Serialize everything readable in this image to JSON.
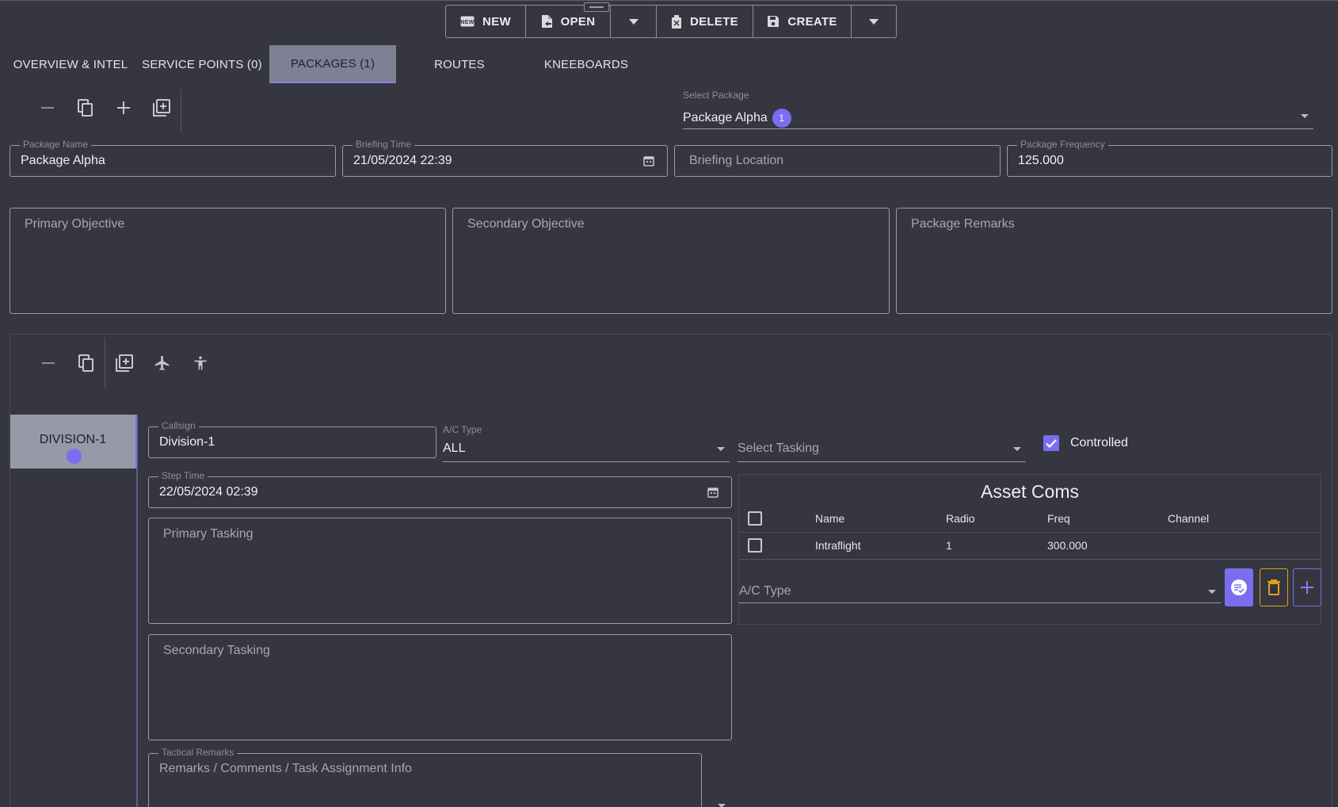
{
  "toolbar": {
    "new_label": "NEW",
    "open_label": "OPEN",
    "delete_label": "DELETE",
    "create_label": "CREATE"
  },
  "tabs": [
    {
      "label": "OVERVIEW & INTEL"
    },
    {
      "label": "SERVICE POINTS (0)"
    },
    {
      "label": "PACKAGES (1)",
      "active": true
    },
    {
      "label": "ROUTES"
    },
    {
      "label": "KNEEBOARDS"
    }
  ],
  "package": {
    "select_label": "Select Package",
    "selected": "Package Alpha",
    "badge_count": "1",
    "name_label": "Package Name",
    "name_value": "Package Alpha",
    "briefing_time_label": "Briefing Time",
    "briefing_time_value": "21/05/2024 22:39",
    "briefing_location_placeholder": "Briefing Location",
    "frequency_label": "Package Frequency",
    "frequency_value": "125.000",
    "primary_objective_placeholder": "Primary Objective",
    "secondary_objective_placeholder": "Secondary Objective",
    "remarks_placeholder": "Package Remarks"
  },
  "flight": {
    "division_tab": "DIVISION-1",
    "callsign_label": "Callsign",
    "callsign_value": "Division-1",
    "ac_type_label": "A/C Type",
    "ac_type_value": "ALL",
    "tasking_placeholder": "Select Tasking",
    "controlled_label": "Controlled",
    "controlled_checked": true,
    "step_time_label": "Step Time",
    "step_time_value": "22/05/2024 02:39",
    "primary_tasking_placeholder": "Primary Tasking",
    "secondary_tasking_placeholder": "Secondary Tasking",
    "tactical_remarks_label": "Tactical Remarks",
    "tactical_remarks_placeholder": "Remarks / Comments / Task Assignment Info"
  },
  "asset_coms": {
    "title": "Asset Coms",
    "columns": [
      "Name",
      "Radio",
      "Freq",
      "Channel"
    ],
    "rows": [
      {
        "name": "Intraflight",
        "radio": "1",
        "freq": "300.000",
        "channel": ""
      }
    ],
    "ac_type_placeholder": "A/C Type"
  },
  "colors": {
    "background": "#35363f",
    "accent": "#7b6df0",
    "warning": "#e0a21b",
    "active_tab": "#7e8194"
  }
}
